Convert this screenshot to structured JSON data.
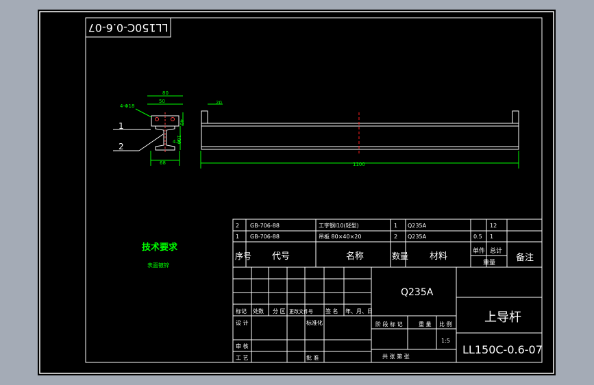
{
  "drawing": {
    "mirrored_code": "LL150C-0.6-07",
    "tech_req": {
      "title": "技术要求",
      "note": "表面镀锌"
    },
    "dims": {
      "holes": "4-Φ18",
      "top_outer": "80",
      "top_inner": "50",
      "side_height": "40",
      "web_height": "100",
      "web_thick": "4.5",
      "bottom_width": "68",
      "end_width": "20",
      "length": "1100"
    },
    "balloons": [
      "1",
      "2"
    ]
  },
  "bom": {
    "rows": [
      {
        "seq": "2",
        "code": "GB-706-88",
        "name": "工字钢I10(轻型)",
        "qty": "1",
        "material": "Q235A",
        "unit_w": "",
        "total_w": "12"
      },
      {
        "seq": "1",
        "code": "GB-706-88",
        "name": "吊板 80×40×20",
        "qty": "2",
        "material": "Q235A",
        "unit_w": "0.5",
        "total_w": "1"
      }
    ],
    "header": {
      "seq": "序号",
      "code": "代号",
      "name": "名称",
      "qty": "数量",
      "material": "材料",
      "unit": "单件",
      "total": "总计",
      "weight": "重量",
      "remark": "备注"
    }
  },
  "title_block": {
    "material": "Q235A",
    "part_name": "上导杆",
    "drawing_no": "LL150C-0.6-07",
    "labels": {
      "mark": "标记",
      "count": "处数",
      "zone": "分 区",
      "change_doc": "更改文件号",
      "sign": "签 名",
      "date": "年、月、日",
      "design": "设 计",
      "standardize": "标准化",
      "stage_mark": "阶 段 标 记",
      "weight": "重 量",
      "scale": "比 例",
      "review": "审 核",
      "process": "工 艺",
      "approve": "批 准",
      "total_sheets": "共 张 第 张"
    },
    "scale_value": "1:5"
  }
}
